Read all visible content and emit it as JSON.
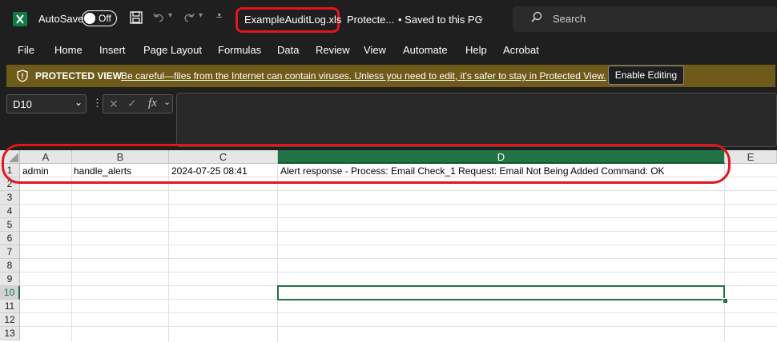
{
  "titlebar": {
    "app_icon": "excel-icon",
    "autosave_label": "AutoSave",
    "autosave_state": "Off",
    "filename": "ExampleAuditLog.xls",
    "protected_label": "Protecte...",
    "saved_label": "• Saved to this PC",
    "search_placeholder": "Search"
  },
  "menu": [
    "File",
    "Home",
    "Insert",
    "Page Layout",
    "Formulas",
    "Data",
    "Review",
    "View",
    "Automate",
    "Help",
    "Acrobat"
  ],
  "protected_view": {
    "title": "PROTECTED VIEW",
    "message": "Be careful—files from the Internet can contain viruses. Unless you need to edit, it's safer to stay in Protected View.",
    "button": "Enable Editing"
  },
  "formula_bar": {
    "name_box": "D10",
    "fx": "fx"
  },
  "sheet": {
    "columns": [
      "A",
      "B",
      "C",
      "D",
      "E"
    ],
    "rows": [
      "1",
      "2",
      "3",
      "4",
      "5",
      "6",
      "7",
      "8",
      "9",
      "10",
      "11",
      "12",
      "13"
    ],
    "row1": [
      "admin",
      "handle_alerts",
      "2024-07-25 08:41",
      "Alert response - Process: Email Check_1 Request: Email Not Being Added Command: OK",
      ""
    ]
  },
  "colors": {
    "chrome": "#1f1f1f",
    "protected_bar": "#6e5b1a",
    "selection": "#217346",
    "annotation": "#e0161b"
  }
}
